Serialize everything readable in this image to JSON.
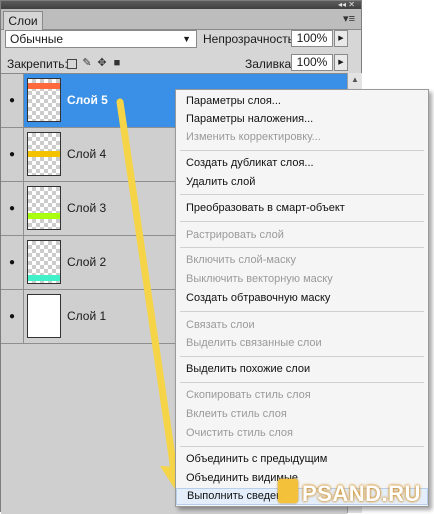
{
  "panel": {
    "tab_label": "Слои",
    "window_controls": "◂◂ ✕",
    "menu_glyph": "▾≡",
    "blend_mode": "Обычные",
    "opacity_label": "Непрозрачность:",
    "opacity_value": "100%",
    "lock_label": "Закрепить:",
    "fill_label": "Заливка:",
    "fill_value": "100%"
  },
  "layers": [
    {
      "name": "Слой 5",
      "selected": true,
      "stripe_color": "#ff6a3d"
    },
    {
      "name": "Слой 4",
      "selected": false,
      "stripe_color": "#f5c200"
    },
    {
      "name": "Слой 3",
      "selected": false,
      "stripe_color": "#a8ff10"
    },
    {
      "name": "Слой 2",
      "selected": false,
      "stripe_color": "#3ff0c8"
    },
    {
      "name": "Слой 1",
      "selected": false,
      "stripe_color": "#ffffff"
    }
  ],
  "context_menu": {
    "items": [
      {
        "label": "Параметры слоя...",
        "enabled": true
      },
      {
        "label": "Параметры наложения...",
        "enabled": true
      },
      {
        "label": "Изменить корректировку...",
        "enabled": false
      },
      {
        "label": "Создать дубликат слоя...",
        "enabled": true
      },
      {
        "label": "Удалить слой",
        "enabled": true
      },
      {
        "label": "Преобразовать в смарт-объект",
        "enabled": true
      },
      {
        "label": "Растрировать слой",
        "enabled": false
      },
      {
        "label": "Включить слой-маску",
        "enabled": false
      },
      {
        "label": "Выключить векторную маску",
        "enabled": false
      },
      {
        "label": "Создать обтравочную маску",
        "enabled": true
      },
      {
        "label": "Связать слои",
        "enabled": false
      },
      {
        "label": "Выделить связанные слои",
        "enabled": false
      },
      {
        "label": "Выделить похожие слои",
        "enabled": true
      },
      {
        "label": "Скопировать стиль слоя",
        "enabled": false
      },
      {
        "label": "Вклеить стиль слоя",
        "enabled": false
      },
      {
        "label": "Очистить стиль слоя",
        "enabled": false
      },
      {
        "label": "Объединить с предыдущим",
        "enabled": true
      },
      {
        "label": "Объединить видимые",
        "enabled": true
      },
      {
        "label": "Выполнить сведение",
        "enabled": true,
        "highlighted": true
      }
    ]
  },
  "watermark": "PSAND.RU",
  "colors": {
    "selection": "#3a8fe6",
    "arrow": "#f5d547",
    "menu_bg": "#f5f5f5"
  },
  "icons": [
    "eye-icon",
    "lock-transparency-icon",
    "lock-brush-icon",
    "lock-move-icon",
    "lock-all-icon",
    "dropdown-arrow-icon",
    "spin-arrow-icon",
    "panel-menu-icon"
  ]
}
